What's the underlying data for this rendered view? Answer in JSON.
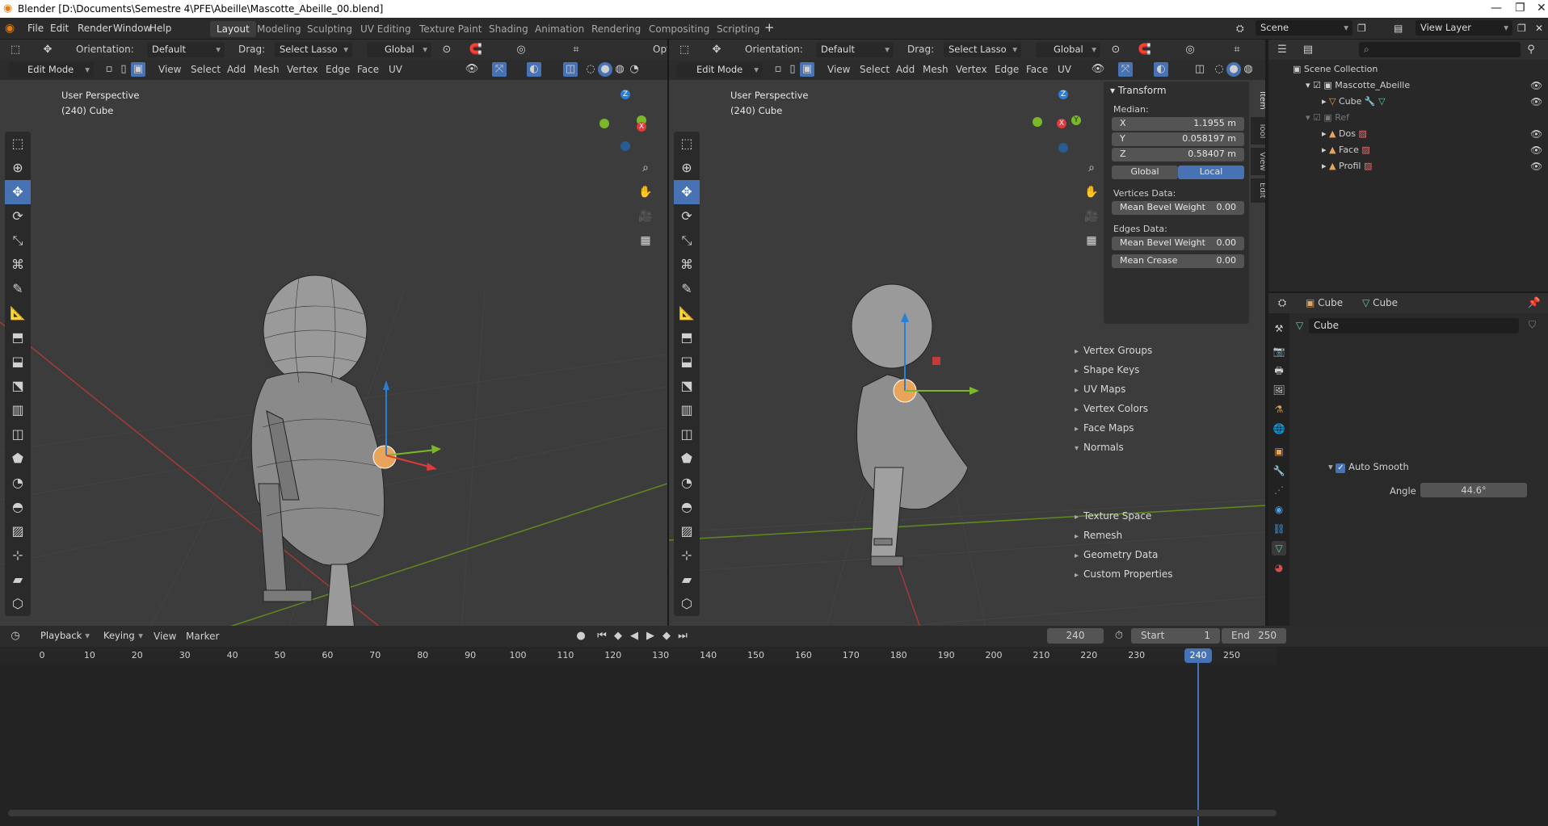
{
  "window": {
    "title": "Blender [D:\\Documents\\Semestre 4\\PFE\\Abeille\\Mascotte_Abeille_00.blend]"
  },
  "menu": [
    "File",
    "Edit",
    "Render",
    "Window",
    "Help"
  ],
  "workspaces": [
    "Layout",
    "Modeling",
    "Sculpting",
    "UV Editing",
    "Texture Paint",
    "Shading",
    "Animation",
    "Rendering",
    "Compositing",
    "Scripting"
  ],
  "scene": {
    "name": "Scene",
    "view_layer": "View Layer"
  },
  "left_viewport": {
    "toolheader": {
      "orientation_label": "Orientation:",
      "orientation": "Default",
      "drag_label": "Drag:",
      "drag": "Select Lasso",
      "transform": "Global",
      "overflow": "Opt"
    },
    "header": {
      "mode": "Edit Mode",
      "menus": [
        "View",
        "Select",
        "Add",
        "Mesh",
        "Vertex",
        "Edge",
        "Face",
        "UV"
      ]
    },
    "overlay_text": [
      "User Perspective",
      "(240) Cube"
    ]
  },
  "right_viewport": {
    "toolheader": {
      "orientation_label": "Orientation:",
      "orientation": "Default",
      "drag_label": "Drag:",
      "drag": "Select Lasso",
      "transform": "Global"
    },
    "header": {
      "mode": "Edit Mode",
      "menus": [
        "View",
        "Select",
        "Add",
        "Mesh",
        "Vertex",
        "Edge",
        "Face",
        "UV"
      ]
    },
    "overlay_text": [
      "User Perspective",
      "(240) Cube"
    ],
    "npanel": {
      "title": "Transform",
      "median_label": "Median:",
      "x": {
        "label": "X",
        "value": "1.1955 m"
      },
      "y": {
        "label": "Y",
        "value": "0.058197 m"
      },
      "z": {
        "label": "Z",
        "value": "0.58407 m"
      },
      "space_global": "Global",
      "space_local": "Local",
      "vertices_label": "Vertices Data:",
      "v_mean_bevel": {
        "label": "Mean Bevel Weight",
        "value": "0.00"
      },
      "edges_label": "Edges Data:",
      "e_mean_bevel": {
        "label": "Mean Bevel Weight",
        "value": "0.00"
      },
      "e_mean_crease": {
        "label": "Mean Crease",
        "value": "0.00"
      },
      "tabs": [
        "Item",
        "Tool",
        "View",
        "Edit"
      ]
    }
  },
  "outliner": {
    "root": "Scene Collection",
    "items": [
      {
        "name": "Mascotte_Abeille",
        "level": 1
      },
      {
        "name": "Cube",
        "level": 2
      },
      {
        "name": "Ref",
        "level": 1
      },
      {
        "name": "Dos",
        "level": 2
      },
      {
        "name": "Face",
        "level": 2
      },
      {
        "name": "Profil",
        "level": 2
      }
    ]
  },
  "properties": {
    "object": "Cube",
    "data": "Cube",
    "mesh_name": "Cube",
    "panels": [
      "Vertex Groups",
      "Shape Keys",
      "UV Maps",
      "Vertex Colors",
      "Face Maps",
      "Normals",
      "Texture Space",
      "Remesh",
      "Geometry Data",
      "Custom Properties"
    ],
    "auto_smooth": "Auto Smooth",
    "angle_label": "Angle",
    "angle_value": "44.6°"
  },
  "timeline": {
    "menus": [
      "Playback",
      "Keying",
      "View",
      "Marker"
    ],
    "current_frame": "240",
    "start_label": "Start",
    "start": "1",
    "end_label": "End",
    "end": "250",
    "ticks": [
      "0",
      "10",
      "20",
      "30",
      "40",
      "50",
      "60",
      "70",
      "80",
      "90",
      "100",
      "110",
      "120",
      "130",
      "140",
      "150",
      "160",
      "170",
      "180",
      "190",
      "200",
      "210",
      "220",
      "230",
      "240",
      "250"
    ],
    "playhead": "240"
  },
  "colors": {
    "accent": "#4772b3",
    "x_axis": "#c33a3a",
    "y_axis": "#7ab82a",
    "z_axis": "#2a7fd4"
  }
}
